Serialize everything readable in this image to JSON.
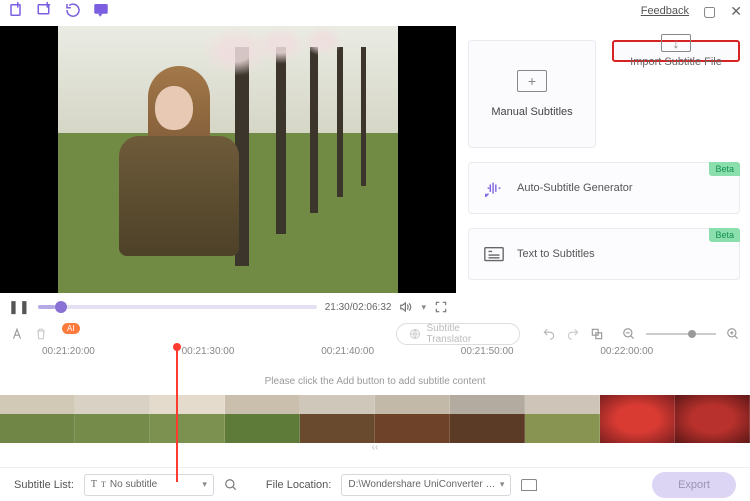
{
  "titlebar": {
    "feedback": "Feedback"
  },
  "player": {
    "current": "21:30",
    "duration": "02:06:32"
  },
  "tools": {
    "ai_badge": "AI",
    "translator": "Subtitle Translator"
  },
  "cards": {
    "manual": "Manual Subtitles",
    "import": "Import Subtitle File",
    "auto": "Auto-Subtitle Generator",
    "text": "Text to Subtitles",
    "beta": "Beta"
  },
  "timeline": {
    "ticks": [
      "00:21:20:00",
      "00:21:30:00",
      "00:21:40:00",
      "00:21:50:00",
      "00:22:00:00"
    ],
    "empty": "Please click the Add button to add subtitle content",
    "scroll_hint": "‹‹"
  },
  "bottom": {
    "list_label": "Subtitle List:",
    "list_value": "No subtitle",
    "loc_label": "File Location:",
    "loc_value": "D:\\Wondershare UniConverter …",
    "export": "Export"
  }
}
